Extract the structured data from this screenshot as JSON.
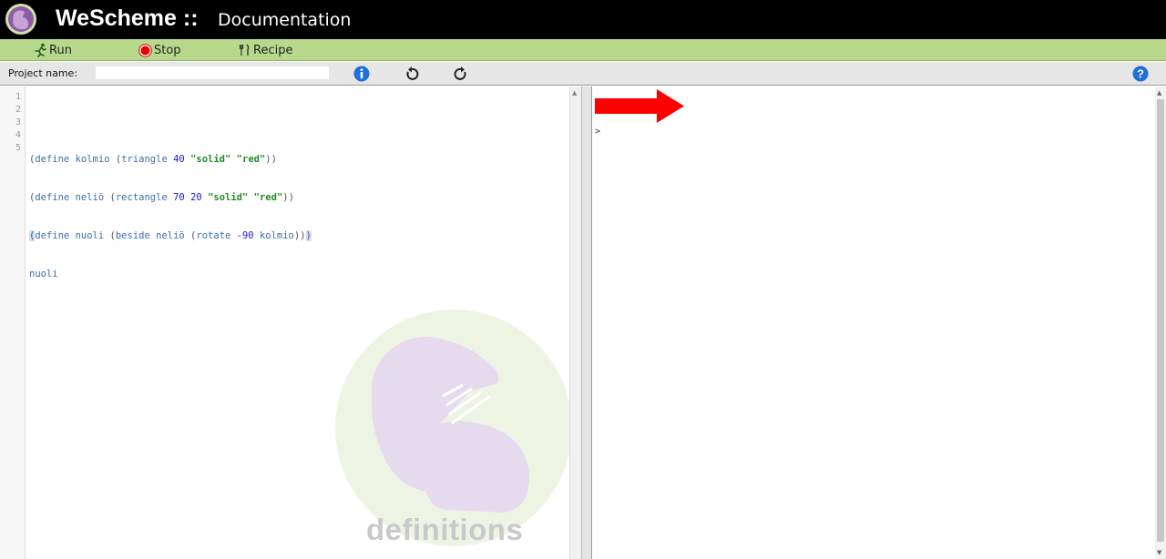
{
  "header": {
    "brand": "WeScheme ::",
    "subtitle": "Documentation"
  },
  "toolbar": {
    "run_label": "Run",
    "stop_label": "Stop",
    "recipe_label": "Recipe"
  },
  "project": {
    "label": "Project name:",
    "value": ""
  },
  "editor": {
    "line_numbers": [
      "1",
      "2",
      "3",
      "4",
      "5"
    ]
  },
  "interactions": {
    "prompt": ">"
  },
  "watermark": {
    "text": "definitions"
  },
  "colors": {
    "header_bg": "#000000",
    "toolbar_bg": "#b8d98b",
    "arrow_red": "#ff0000",
    "keyword": "#3a6fa8",
    "number": "#1a1ad1",
    "string": "#228b22"
  }
}
